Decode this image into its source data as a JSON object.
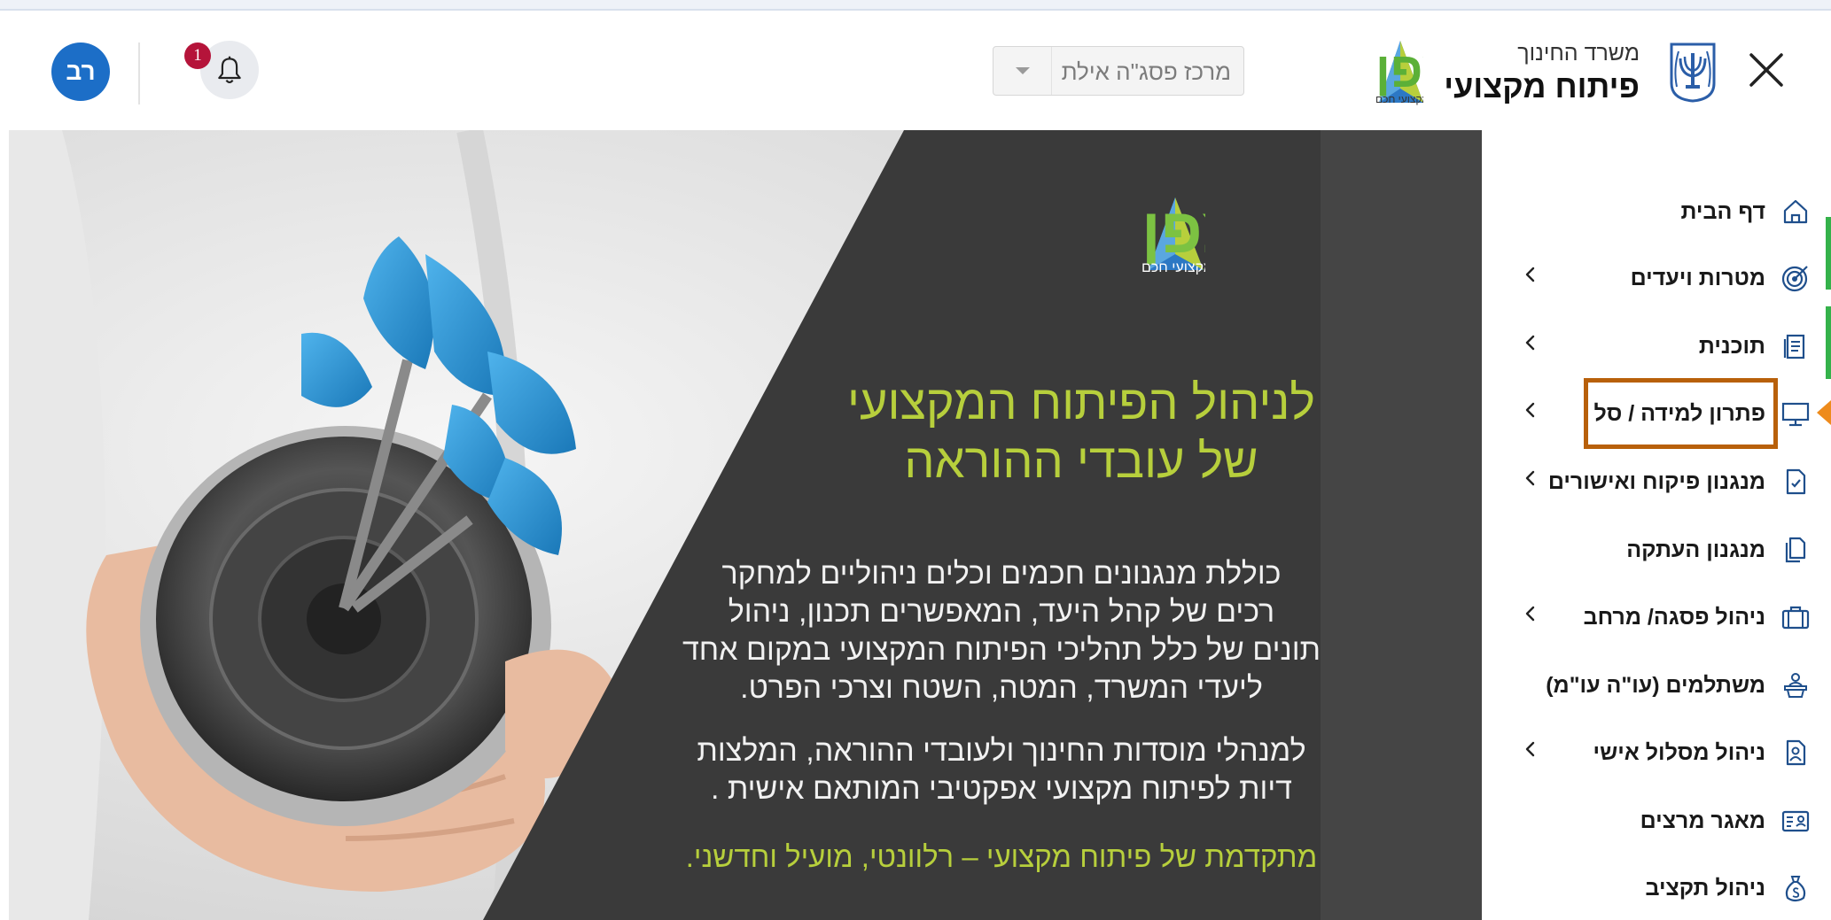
{
  "header": {
    "ministry_name": "משרד החינוך",
    "ministry_subtitle": "פיתוח מקצועי",
    "logo_text": "מצפן",
    "logo_subtitle": "פיתוח מקצועי חכם",
    "center_select_value": "מרכז פסג\"ה אילת",
    "notification_count": "1",
    "avatar_initials": "רב"
  },
  "hero": {
    "logo_text": "מצפן",
    "logo_subtitle": "פיתוח מקצועי חכם",
    "title_line1": "לניהול הפיתוח המקצועי",
    "title_line2": "של עובדי ההוראה",
    "body_lines": [
      "כוללת מנגנונים חכמים וכלים ניהוליים למחקר",
      "רכים  של קהל היעד, המאפשרים תכנון, ניהול",
      "תונים של כלל תהליכי הפיתוח המקצועי במקום אחד",
      "ליעדי המשרד, המטה, השטח וצרכי הפרט."
    ],
    "body2_lines": [
      "למנהלי מוסדות החינוך ולעובדי ההוראה, המלצות",
      "דיות לפיתוח מקצועי אפקטיבי המותאם אישית ."
    ],
    "tagline": "מתקדמת של פיתוח מקצועי – רלוונטי, מועיל וחדשני."
  },
  "sidebar": {
    "items": [
      {
        "label": "דף הבית",
        "icon": "home-icon",
        "has_chevron": false
      },
      {
        "label": "מטרות ויעדים",
        "icon": "target-icon",
        "has_chevron": true
      },
      {
        "label": "תוכנית",
        "icon": "document-icon",
        "has_chevron": true
      },
      {
        "label": "פתרון למידה / סל",
        "icon": "monitor-icon",
        "has_chevron": true,
        "active": true
      },
      {
        "label": "מנגנון פיקוח ואישורים",
        "icon": "file-check-icon",
        "has_chevron": true
      },
      {
        "label": "מנגנון העתקה",
        "icon": "copy-icon",
        "has_chevron": false
      },
      {
        "label": "ניהול פסגה/ מרחב",
        "icon": "briefcase-icon",
        "has_chevron": true
      },
      {
        "label": "משתלמים (עו\"ה עו\"מ)",
        "icon": "people-icon",
        "has_chevron": false
      },
      {
        "label": "ניהול מסלול אישי",
        "icon": "user-file-icon",
        "has_chevron": true
      },
      {
        "label": "מאגר מרצים",
        "icon": "id-card-icon",
        "has_chevron": false
      },
      {
        "label": "ניהול תקציב",
        "icon": "money-bag-icon",
        "has_chevron": false
      }
    ]
  },
  "colors": {
    "brand_green": "#b7cf3c",
    "avatar_blue": "#1c6ec7",
    "badge_red": "#b5143a",
    "highlight_border": "#b8600a",
    "active_marker": "#ee8b1c",
    "accent_green_bar": "#34b24a"
  }
}
